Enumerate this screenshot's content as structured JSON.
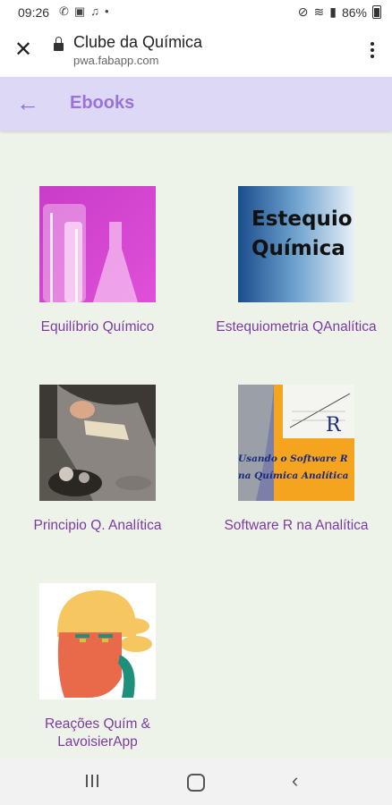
{
  "status_bar": {
    "time": "09:26",
    "battery": "86%"
  },
  "browser": {
    "site_title": "Clube da Química",
    "url": "pwa.fabapp.com"
  },
  "app_bar": {
    "title": "Ebooks"
  },
  "ebooks": [
    {
      "label": "Equilíbrio Químico"
    },
    {
      "label": "Estequiometria QAnalítica",
      "cover_text_line1": "Estequio",
      "cover_text_line2": "Química"
    },
    {
      "label": "Principio Q. Analítica"
    },
    {
      "label": "Software R na Analítica",
      "cover_text_line1": "Usando o Software R",
      "cover_text_line2": "na Química Analítica",
      "cover_letter": "R"
    },
    {
      "label_line1": "Reações Quím &",
      "label_line2": "LavoisierApp"
    }
  ],
  "colors": {
    "accent": "#8e6bd6",
    "label": "#7b3ba0",
    "appbar_bg": "#ddd8f5",
    "page_bg": "#eef3ea"
  }
}
